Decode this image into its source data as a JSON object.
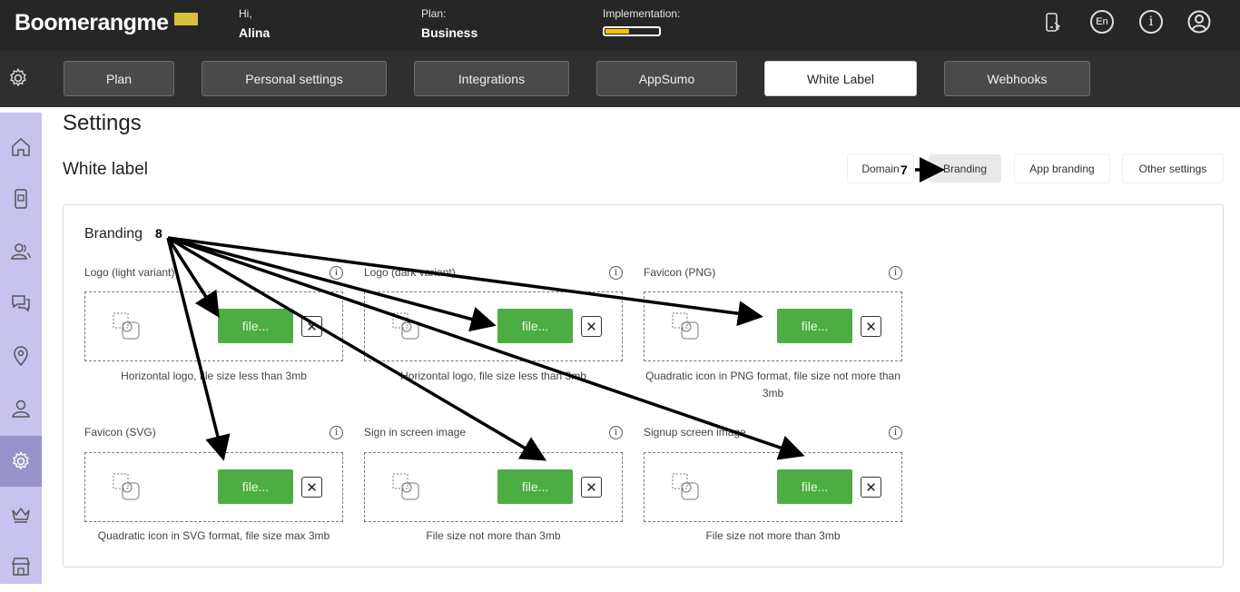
{
  "header": {
    "logo": "Boomerangme",
    "greeting_label": "Hi,",
    "user_name": "Alina",
    "plan_label": "Plan:",
    "plan_value": "Business",
    "implementation_label": "Implementation:",
    "implementation_progress": 0.45,
    "language": "En",
    "icons": [
      "phone-icon",
      "language-icon",
      "info-icon",
      "profile-icon"
    ]
  },
  "tabs": [
    {
      "label": "Plan"
    },
    {
      "label": "Personal settings"
    },
    {
      "label": "Integrations"
    },
    {
      "label": "AppSumo"
    },
    {
      "label": "White Label",
      "active": true
    },
    {
      "label": "Webhooks"
    }
  ],
  "sidebar": {
    "items": [
      "home-icon",
      "card-icon",
      "customers-icon",
      "chat-icon",
      "location-icon",
      "user-icon",
      "settings-icon",
      "crown-icon",
      "store-icon"
    ],
    "active": "settings-icon"
  },
  "page": {
    "title": "Settings",
    "section": "White label",
    "sub_tabs": [
      {
        "label": "Domain"
      },
      {
        "label": "Branding",
        "active": true
      },
      {
        "label": "App branding"
      },
      {
        "label": "Other settings"
      }
    ]
  },
  "branding": {
    "title": "Branding",
    "file_label": "file...",
    "clear_label": "✕",
    "fields": [
      {
        "label": "Logo (light variant)",
        "hint": "Horizontal logo, file size less than 3mb"
      },
      {
        "label": "Logo (dark variant)",
        "hint": "Horizontal logo, file size less than 3mb"
      },
      {
        "label": "Favicon (PNG)",
        "hint": "Quadratic icon in PNG format, file size not more than 3mb"
      },
      {
        "label": "Favicon (SVG)",
        "hint": "Quadratic icon in SVG format, file size max 3mb"
      },
      {
        "label": "Sign in screen image",
        "hint": "File size not more than 3mb"
      },
      {
        "label": "Signup screen image",
        "hint": "File size not more than 3mb"
      }
    ]
  },
  "annotations": {
    "step7": "7",
    "step8": "8"
  },
  "colors": {
    "topbar": "#262626",
    "sidebar": "#c7c3ee",
    "sidebar_active": "#9892cb",
    "file_button": "#4cae42",
    "progress": "#f5c400"
  }
}
